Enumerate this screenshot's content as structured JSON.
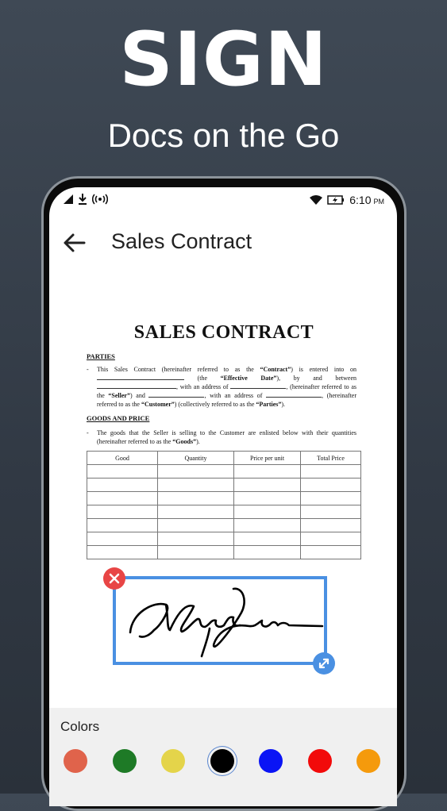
{
  "promo": {
    "headline": "SIGN",
    "subheadline": "Docs on the Go"
  },
  "status_bar": {
    "time": "6:10",
    "ampm": "PM"
  },
  "app_bar": {
    "title": "Sales Contract",
    "back_icon": "arrow-left-icon"
  },
  "document": {
    "title": "SALES CONTRACT",
    "parties_heading": "PARTIES",
    "parties_p1": "This Sales Contract (hereinafter referred to as the ",
    "parties_contract": "“Contract”",
    "parties_p2": ") is entered into on",
    "parties_p3": " (the ",
    "parties_effective": "“Effective Date”",
    "parties_p4": "), by and between",
    "parties_p5": "with an address of",
    "parties_p6": ", (hereinafter referred to as the ",
    "parties_seller": "“Seller”",
    "parties_p7": ") and",
    "parties_p8": ", with an address of",
    "parties_p9": ", (hereinafter referred to as the",
    "parties_customer": "“Customer”",
    "parties_p10": ") (collectively referred to as the ",
    "parties_parties": "“Parties”",
    "parties_p11": ").",
    "goods_heading": "GOODS AND PRICE",
    "goods_p1": "The goods that the Seller is selling to the Customer are enlisted below with their quantities (hereinafter referred to as the ",
    "goods_goods": "“Goods”",
    "goods_p2": ").",
    "table_headers": [
      "Good",
      "Quantity",
      "Price per unit",
      "Total Price"
    ],
    "table_rows": 7
  },
  "signature": {
    "close_icon": "close-icon",
    "resize_icon": "resize-diagonal-icon",
    "stroke_color": "#000000",
    "frame_color": "#4a90e2"
  },
  "colors_panel": {
    "label": "Colors",
    "swatches": [
      {
        "name": "terracotta",
        "hex": "#e0634b",
        "selected": false
      },
      {
        "name": "green",
        "hex": "#1e7a26",
        "selected": false
      },
      {
        "name": "yellow",
        "hex": "#e4d44a",
        "selected": false
      },
      {
        "name": "black",
        "hex": "#000000",
        "selected": true
      },
      {
        "name": "blue",
        "hex": "#0a14f5",
        "selected": false
      },
      {
        "name": "red",
        "hex": "#f20a0a",
        "selected": false
      },
      {
        "name": "orange",
        "hex": "#f59a0c",
        "selected": false
      }
    ]
  }
}
